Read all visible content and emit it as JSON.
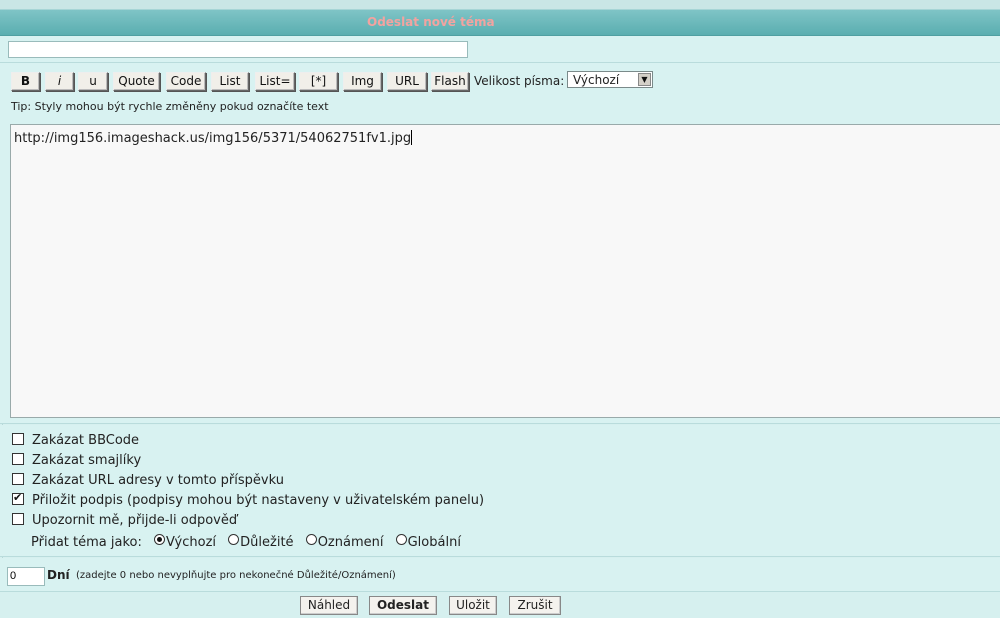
{
  "header": {
    "title": "Odeslat nové téma"
  },
  "subject": {
    "value": ""
  },
  "toolbar": {
    "buttons": [
      "B",
      "i",
      "u",
      "Quote",
      "Code",
      "List",
      "List=",
      "[*]",
      "Img",
      "URL",
      "Flash"
    ],
    "font_size_label": "Velikost písma:",
    "font_size_value": "Výchozí"
  },
  "tip": "Tip: Styly mohou být rychle změněny pokud označíte text",
  "editor": {
    "content": "http://img156.imageshack.us/img156/5371/54062751fv1.jpg"
  },
  "options": [
    {
      "label": "Zakázat BBCode",
      "checked": false
    },
    {
      "label": "Zakázat smajlíky",
      "checked": false
    },
    {
      "label": "Zakázat URL adresy v tomto příspěvku",
      "checked": false
    },
    {
      "label": "Přiložit podpis (podpisy mohou být nastaveny v uživatelském panelu)",
      "checked": true
    },
    {
      "label": "Upozornit mě, přijde-li odpověď",
      "checked": false
    }
  ],
  "post_type": {
    "label": "Přidat téma jako:",
    "choices": [
      "Výchozí",
      "Důležité",
      "Oznámení",
      "Globální"
    ],
    "selected": "Výchozí"
  },
  "days": {
    "value": "0",
    "label": "Dní",
    "hint": "(zadejte 0 nebo nevyplňujte pro nekonečné Důležité/Oznámení)"
  },
  "actions": {
    "preview": "Náhled",
    "submit": "Odeslat",
    "save": "Uložit",
    "cancel": "Zrušit"
  }
}
